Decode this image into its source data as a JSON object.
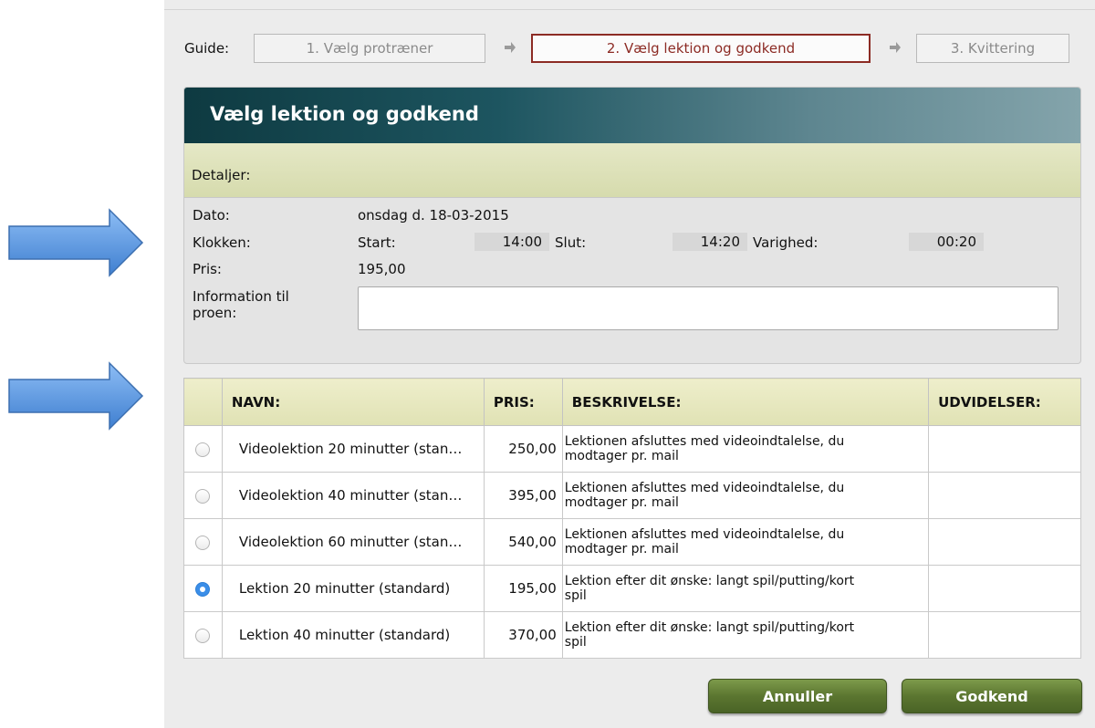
{
  "guide": {
    "label": "Guide:",
    "steps": [
      {
        "label": "1. Vælg protræner",
        "state": "inactive"
      },
      {
        "label": "2. Vælg lektion og godkend",
        "state": "active"
      },
      {
        "label": "3. Kvittering",
        "state": "inactive"
      }
    ]
  },
  "panel": {
    "title": "Vælg lektion og godkend",
    "details_label": "Detaljer:",
    "date_label": "Dato:",
    "date_value": "onsdag d. 18-03-2015",
    "time_label": "Klokken:",
    "start_label": "Start:",
    "start_value": "14:00",
    "end_label": "Slut:",
    "end_value": "14:20",
    "duration_label": "Varighed:",
    "duration_value": "00:20",
    "price_label": "Pris:",
    "price_value": "195,00",
    "info_label_line1": "Information til",
    "info_label_line2": "proen:",
    "info_value": ""
  },
  "table": {
    "headers": {
      "name": "NAVN:",
      "price": "PRIS:",
      "description": "BESKRIVELSE:",
      "extensions": "UDVIDELSER:"
    },
    "rows": [
      {
        "name": "Videolektion 20 minutter (stan…",
        "price": "250,00",
        "desc1": "Lektionen afsluttes med videoindtalelse, du",
        "desc2": "modtager pr. mail",
        "selected": false
      },
      {
        "name": "Videolektion 40 minutter (stan…",
        "price": "395,00",
        "desc1": "Lektionen afsluttes med videoindtalelse, du",
        "desc2": "modtager pr. mail",
        "selected": false
      },
      {
        "name": "Videolektion 60 minutter (stan…",
        "price": "540,00",
        "desc1": "Lektionen afsluttes med videoindtalelse, du",
        "desc2": "modtager pr. mail",
        "selected": false
      },
      {
        "name": "Lektion 20 minutter (standard)",
        "price": "195,00",
        "desc1": "Lektion efter dit ønske: langt spil/putting/kort",
        "desc2": "spil",
        "selected": true
      },
      {
        "name": "Lektion 40 minutter (standard)",
        "price": "370,00",
        "desc1": "Lektion efter dit ønske: langt spil/putting/kort",
        "desc2": "spil",
        "selected": false
      }
    ]
  },
  "buttons": {
    "cancel": "Annuller",
    "approve": "Godkend"
  },
  "colors": {
    "active_step": "#8c2b24",
    "button_green": "#5b7630",
    "header_teal": "#0e3a41",
    "arrow_blue": "#4a90e2"
  }
}
